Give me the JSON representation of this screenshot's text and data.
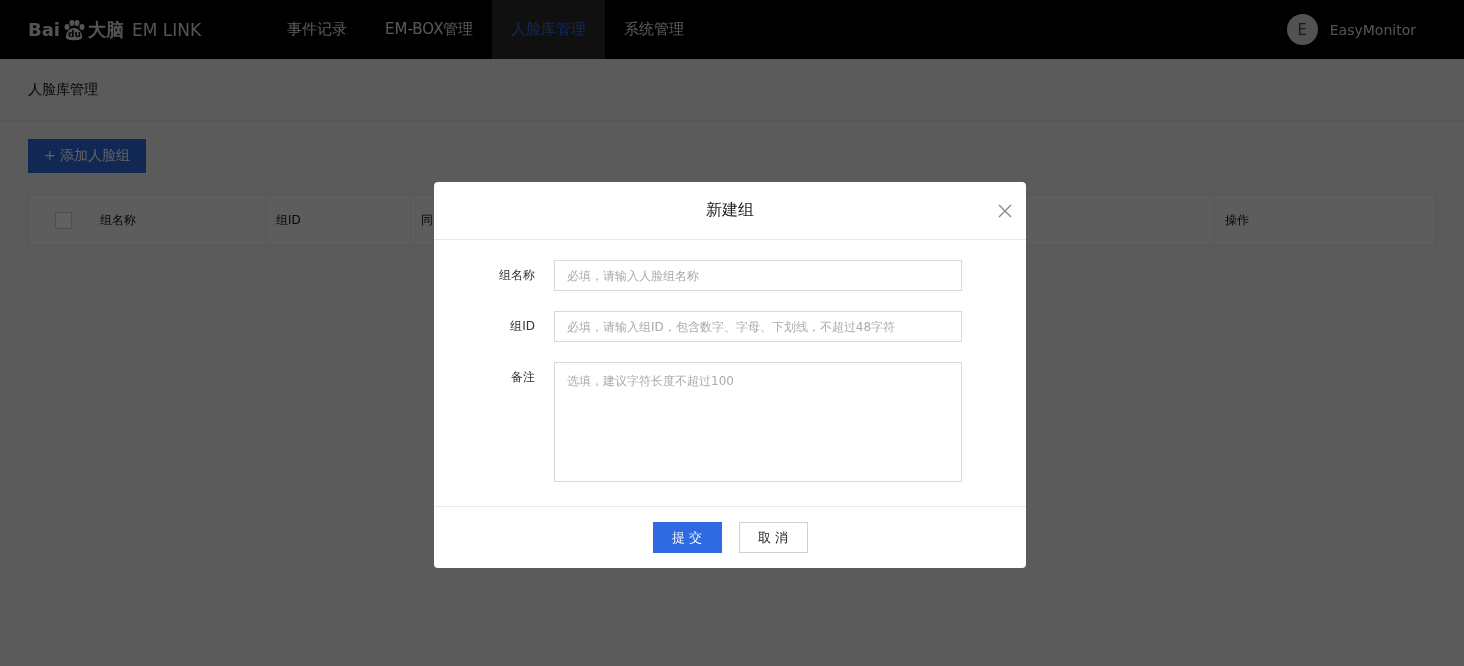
{
  "logo": {
    "prefix": "Bai",
    "paw_text": "du",
    "suffix": "大脑",
    "product": "EM LINK"
  },
  "nav": [
    {
      "label": "事件记录",
      "selected": false
    },
    {
      "label": "EM-BOX管理",
      "selected": false
    },
    {
      "label": "人脸库管理",
      "selected": true
    },
    {
      "label": "系统管理",
      "selected": false
    }
  ],
  "user": {
    "initial": "E",
    "name": "EasyMonitor"
  },
  "page_title": "人脸库管理",
  "add_button": "+ 添加人脸组",
  "table": {
    "checked": false,
    "columns": [
      "组名称",
      "组ID",
      "同",
      "操作"
    ]
  },
  "dialog": {
    "title": "新建组",
    "fields": [
      {
        "kind": "input",
        "label": "组名称",
        "placeholder": "必填，请输入人脸组名称"
      },
      {
        "kind": "input",
        "label": "组ID",
        "placeholder": "必填，请输入组ID，包含数字、字母、下划线，不超过48字符"
      },
      {
        "kind": "textarea",
        "label": "备注",
        "placeholder": "选填，建议字符长度不超过100"
      }
    ],
    "buttons": [
      {
        "kind": "primary",
        "label": "提 交"
      },
      {
        "kind": "default",
        "label": "取 消"
      }
    ]
  }
}
